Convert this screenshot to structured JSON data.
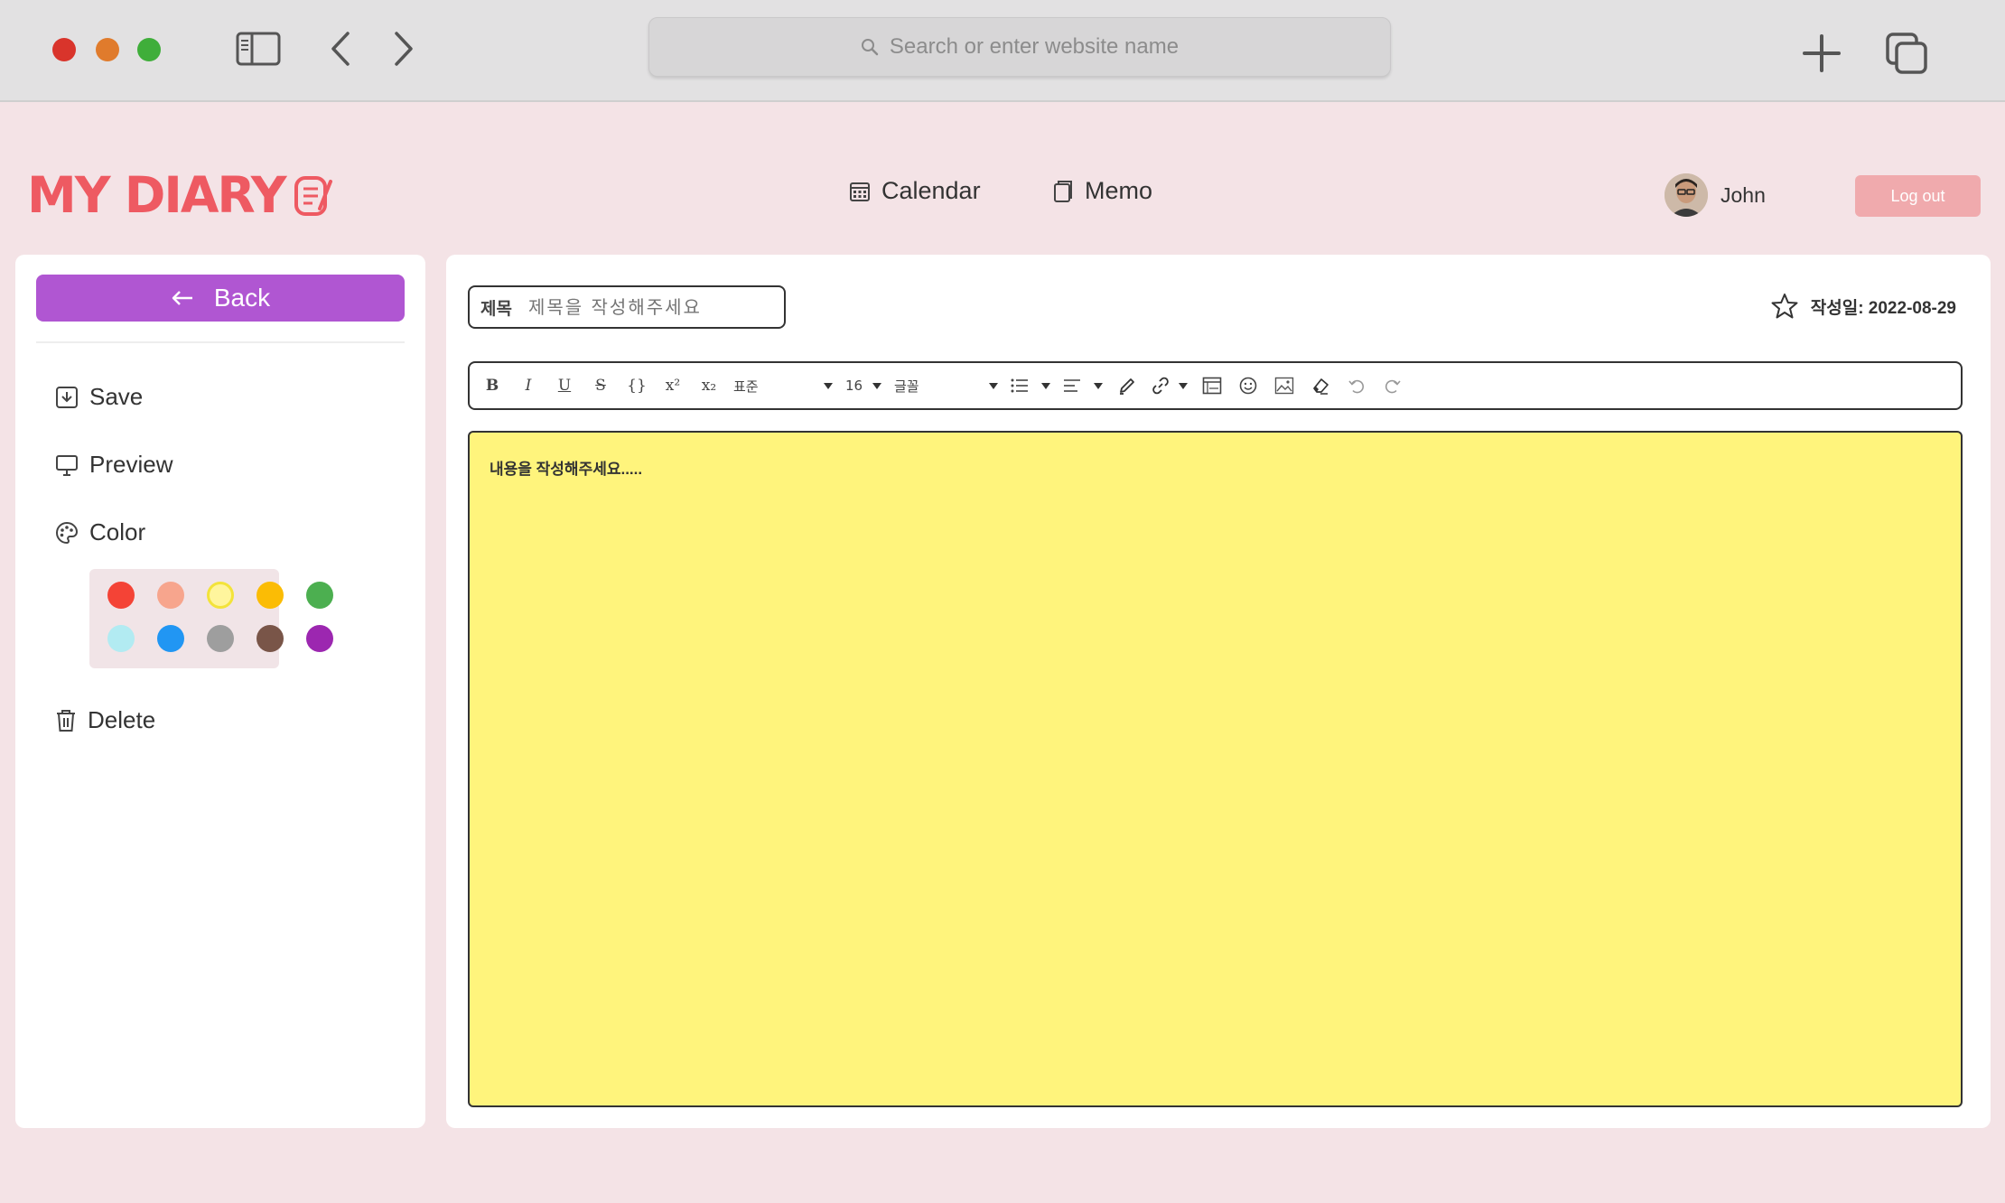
{
  "browser": {
    "search_placeholder": "Search or enter website name",
    "traffic_lights": {
      "close": "#d9342b",
      "minimize": "#e07b2c",
      "maximize": "#3fae3a"
    }
  },
  "header": {
    "logo": "MY DIARY",
    "nav": [
      {
        "label": "Calendar",
        "icon": "calendar-icon"
      },
      {
        "label": "Memo",
        "icon": "memo-icon"
      }
    ],
    "user_name": "John",
    "logout_label": "Log out"
  },
  "sidebar": {
    "back_label": "Back",
    "save_label": "Save",
    "preview_label": "Preview",
    "color_label": "Color",
    "delete_label": "Delete",
    "palette": [
      "#f44336",
      "#f7a58d",
      "#fff59d",
      "#fbbc05",
      "#4caf50",
      "#b2ebf2",
      "#2196f3",
      "#9e9e9e",
      "#795548",
      "#9c27b0"
    ],
    "selected_color": "#fff59d"
  },
  "editor": {
    "title_label": "제목",
    "title_placeholder": "제목을 작성해주세요",
    "date_label": "작성일: 2022-08-29",
    "toolbar": {
      "bold": "B",
      "italic": "I",
      "underline": "U",
      "strike": "S",
      "code": "{}",
      "superscript": "x²",
      "subscript": "x₂",
      "style_select": "표준",
      "size_select": "16",
      "font_select": "글꼴"
    },
    "content_placeholder": "내용을 작성해주세요.....",
    "background_color": "#fff47c"
  },
  "colors": {
    "brand": "#ee5a62",
    "back_button": "#b056d2",
    "logout_button": "#f0aaad",
    "page_bg": "#f4e3e6"
  }
}
